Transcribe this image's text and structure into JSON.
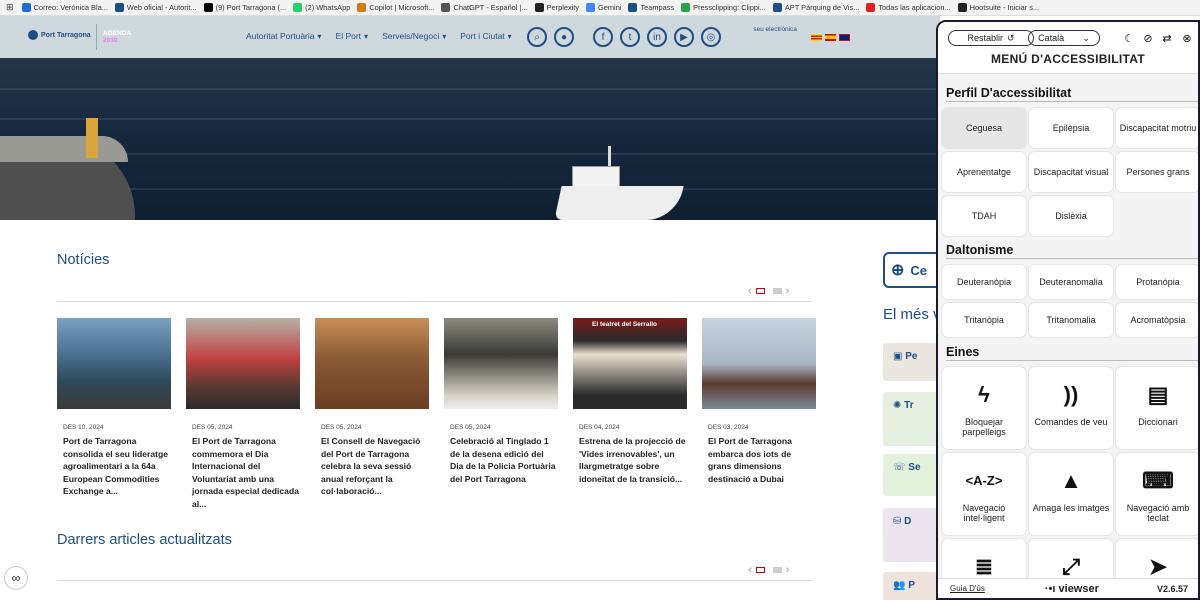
{
  "bookmarks": [
    {
      "label": "Correo: Verónica Bla...",
      "color": "#1e6fd0"
    },
    {
      "label": "Web oficial - Autorit...",
      "color": "#1d4f86"
    },
    {
      "label": "(9) Port Tarragona (...",
      "color": "#000000"
    },
    {
      "label": "(2) WhatsApp",
      "color": "#25d366"
    },
    {
      "label": "Copilot | Microsoft...",
      "color": "#d87a1a"
    },
    {
      "label": "ChatGPT - Español |...",
      "color": "#555555"
    },
    {
      "label": "Perplexity",
      "color": "#222222"
    },
    {
      "label": "Gemini",
      "color": "#4285f4"
    },
    {
      "label": "Teampass",
      "color": "#1d4f86"
    },
    {
      "label": "Pressclipping: Clippi...",
      "color": "#2aa34a"
    },
    {
      "label": "APT Pàrquing de Vis...",
      "color": "#1d4f86"
    },
    {
      "label": "Todas las aplicacion...",
      "color": "#e02020"
    },
    {
      "label": "Hootsuite - Iniciar s...",
      "color": "#222222"
    }
  ],
  "header": {
    "logo": "Port Tarragona",
    "logo2_top": "AGENDA",
    "logo2_year": "2030",
    "nav": [
      "Autoritat Portuària",
      "El Port",
      "Serveis/Negoci",
      "Port i Ciutat"
    ],
    "sede": "seu electrònica"
  },
  "news": {
    "title": "Notícies",
    "cards": [
      {
        "date": "DES 10, 2024",
        "title": "Port de Tarragona consolida el seu lideratge agroalimentari a la 64a European Commodities Exchange a..."
      },
      {
        "date": "DES 05, 2024",
        "title": "El Port de Tarragona commemora el Dia Internacional del Voluntariat amb una jornada especial dedicada al..."
      },
      {
        "date": "DES 05, 2024",
        "title": "El Consell de Navegació del Port de Tarragona celebra la seva sessió anual reforçant la col·laboració..."
      },
      {
        "date": "DES 05, 2024",
        "title": "Celebració al Tinglado 1 de la desena edició del Dia de la Policia Portuària del Port Tarragona"
      },
      {
        "date": "DES 04, 2024",
        "title": "Estrena de la projecció de 'Vides irrenovables', un llargmetratge sobre idoneïtat de la transició..."
      },
      {
        "date": "DES 03, 2024",
        "title": "El Port de Tarragona embarca dos iots de grans dimensions destinació a Dubai"
      }
    ],
    "card4_overlay": "El teatret del Serrallo"
  },
  "articles": {
    "title": "Darrers articles actualitzats"
  },
  "sidebar": {
    "search_label": "Ce",
    "more_title": "El més v",
    "items": [
      "Pe",
      "Tr",
      "Se",
      "D",
      "P"
    ]
  },
  "accessibility": {
    "reset": "Restablir",
    "language": "Català",
    "title": "MENÚ D'ACCESSIBILITAT",
    "profile_heading": "Perfil D'accessibilitat",
    "profiles": [
      "Ceguesa",
      "Epilèpsia",
      "Discapacitat motriu",
      "Aprenentatge",
      "Discapacitat visual",
      "Persones grans",
      "TDAH",
      "Dislèxia"
    ],
    "color_heading": "Daltonisme",
    "colors": [
      "Deuteranòpia",
      "Deuteranomalia",
      "Protanòpia",
      "Tritanòpia",
      "Tritanomalia",
      "Acromatòpsia"
    ],
    "tools_heading": "Eines",
    "tools": [
      "Bloquejar parpelleigs",
      "Comandes de veu",
      "Diccionari",
      "Navegació intel·ligent",
      "Amaga les imatges",
      "Navegació amb teclat"
    ],
    "guide": "Guia D'ús",
    "brand": "viewser",
    "version": "V2.6.57"
  }
}
